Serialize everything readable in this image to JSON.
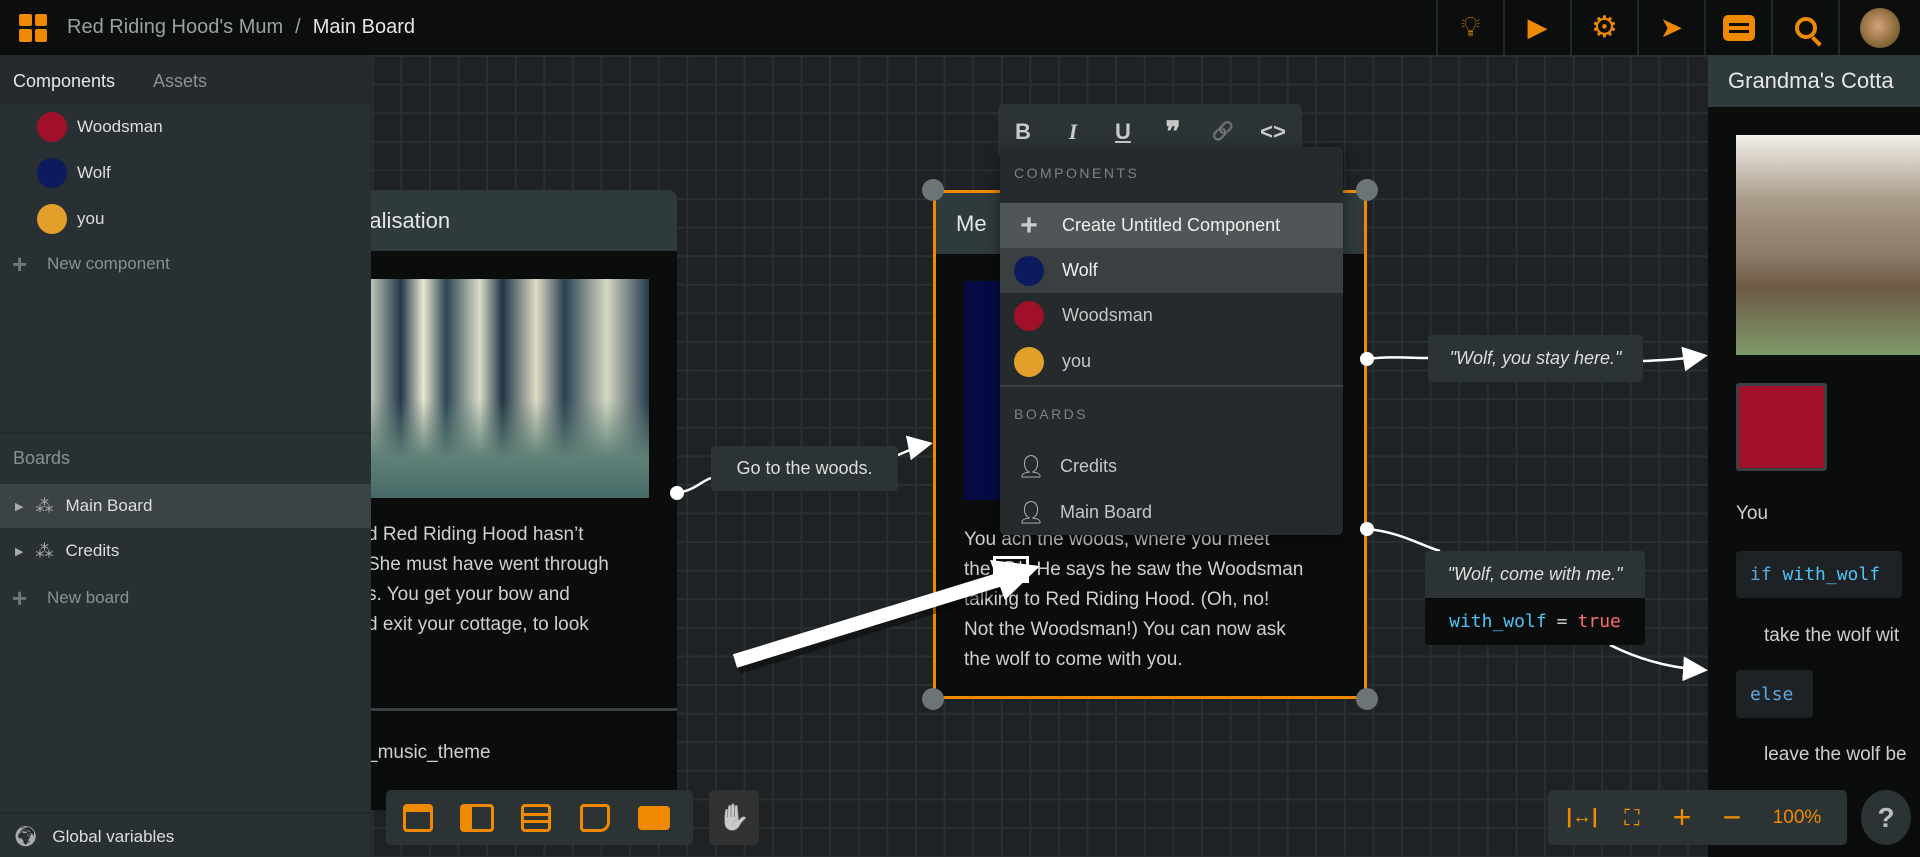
{
  "topbar": {
    "project": "Red Riding Hood's Mum",
    "separator": "/",
    "board": "Main Board",
    "icons": [
      "lightbulb-icon",
      "play-icon",
      "gear-icon",
      "paper-plane-icon",
      "comment-icon",
      "search-icon",
      "user-avatar"
    ]
  },
  "sidebar": {
    "tabs": [
      "Components",
      "Assets"
    ],
    "components": [
      {
        "label": "Woodsman",
        "color": "#a0102a"
      },
      {
        "label": "Wolf",
        "color": "#0c1b5e"
      },
      {
        "label": "you",
        "color": "#e2a02a"
      }
    ],
    "new_component": "New component",
    "boards_header": "Boards",
    "boards": [
      {
        "label": "Main Board",
        "selected": true
      },
      {
        "label": "Credits",
        "selected": false
      }
    ],
    "new_board": "New board",
    "global_variables": "Global variables"
  },
  "left_card": {
    "title": "'s Realisation",
    "text": [
      "d Red Riding Hood hasn’t",
      "She must have went through",
      "s. You get your bow and",
      "d exit your cottage, to look"
    ],
    "footer": "_music_theme"
  },
  "middle_card": {
    "title": "Me",
    "text_line1_start": "You",
    "text_line1_end": "ach the woods, where you meet",
    "text_line2_start": "the",
    "mention": "@",
    "text_line2_end": ". He says he saw the Woodsman",
    "text_rest": [
      "talking to Red Riding Hood. (Oh, no!",
      "Not the Woodsman!) You can now ask",
      "the wolf to come with you."
    ]
  },
  "format_toolbar": {
    "buttons": [
      {
        "name": "bold",
        "glyph": "B"
      },
      {
        "name": "italic",
        "glyph": "I"
      },
      {
        "name": "underline",
        "glyph": "U"
      },
      {
        "name": "quote",
        "glyph": "❞"
      },
      {
        "name": "link",
        "glyph": "🔗"
      },
      {
        "name": "code",
        "glyph": "<>"
      }
    ]
  },
  "mention_dropdown": {
    "components_header": "COMPONENTS",
    "create": "Create Untitled Component",
    "components": [
      {
        "label": "Wolf",
        "color": "#0c1b5e",
        "highlighted": true
      },
      {
        "label": "Woodsman",
        "color": "#a0102a"
      },
      {
        "label": "you",
        "color": "#e2a02a"
      }
    ],
    "boards_header": "BOARDS",
    "boards": [
      "Credits",
      "Main Board"
    ]
  },
  "connections": {
    "go_woods": "Go to the woods.",
    "stay": "\"Wolf, you stay here.\"",
    "come": "\"Wolf, come with me.\"",
    "come_code": {
      "var": "with_wolf",
      "op": "=",
      "val": "true"
    }
  },
  "right_card": {
    "title": "Grandma's Cotta",
    "you": "You",
    "if_code": {
      "kw": "if",
      "var": "with_wolf"
    },
    "take": "take the wolf wit",
    "else": "else",
    "leave": "leave the wolf be"
  },
  "bottom_tools": [
    "card-icon",
    "branch-card-icon",
    "list-card-icon",
    "note-icon",
    "comment-icon"
  ],
  "pan_tool": "hand-icon",
  "zoom": {
    "level": "100%"
  },
  "help": "?",
  "colors": {
    "accent": "#ef8a00",
    "code_var": "#4fc3f7",
    "code_true": "#ff6b6b",
    "code_kw": "#5fa8e0"
  }
}
